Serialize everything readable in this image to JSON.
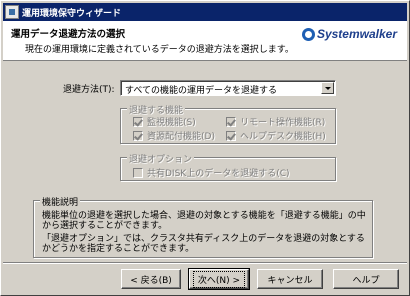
{
  "window": {
    "title": "運用環境保守ウィザード"
  },
  "header": {
    "title": "運用データ退避方法の選択",
    "description": "現在の運用環境に定義されているデータの退避方法を選択します。",
    "brand": "Systemwalker"
  },
  "method": {
    "label": "退避方法(T):",
    "selected": "すべての機能の運用データを退避する"
  },
  "functions_group": {
    "legend": "退避する機能",
    "items": [
      {
        "label": "監視機能(S)",
        "checked": true
      },
      {
        "label": "リモート操作機能(R)",
        "checked": true
      },
      {
        "label": "資源配付機能(D)",
        "checked": true
      },
      {
        "label": "ヘルプデスク機能(H)",
        "checked": true
      }
    ]
  },
  "options_group": {
    "legend": "退避オプション",
    "items": [
      {
        "label": "共有DISK上のデータを退避する(C)",
        "checked": false
      }
    ]
  },
  "description_box": {
    "legend": "機能説明",
    "lines": [
      "機能単位の退避を選択した場合、退避の対象とする機能を「退避する機能」の中から選択することができます。",
      "「退避オプション」では、クラスタ共有ディスク上のデータを退避の対象とするかどうかを指定することができます。"
    ]
  },
  "buttons": {
    "back": "< 戻る(B)",
    "next": "次へ(N) >",
    "cancel": "キャンセル",
    "help": "ヘルプ"
  }
}
